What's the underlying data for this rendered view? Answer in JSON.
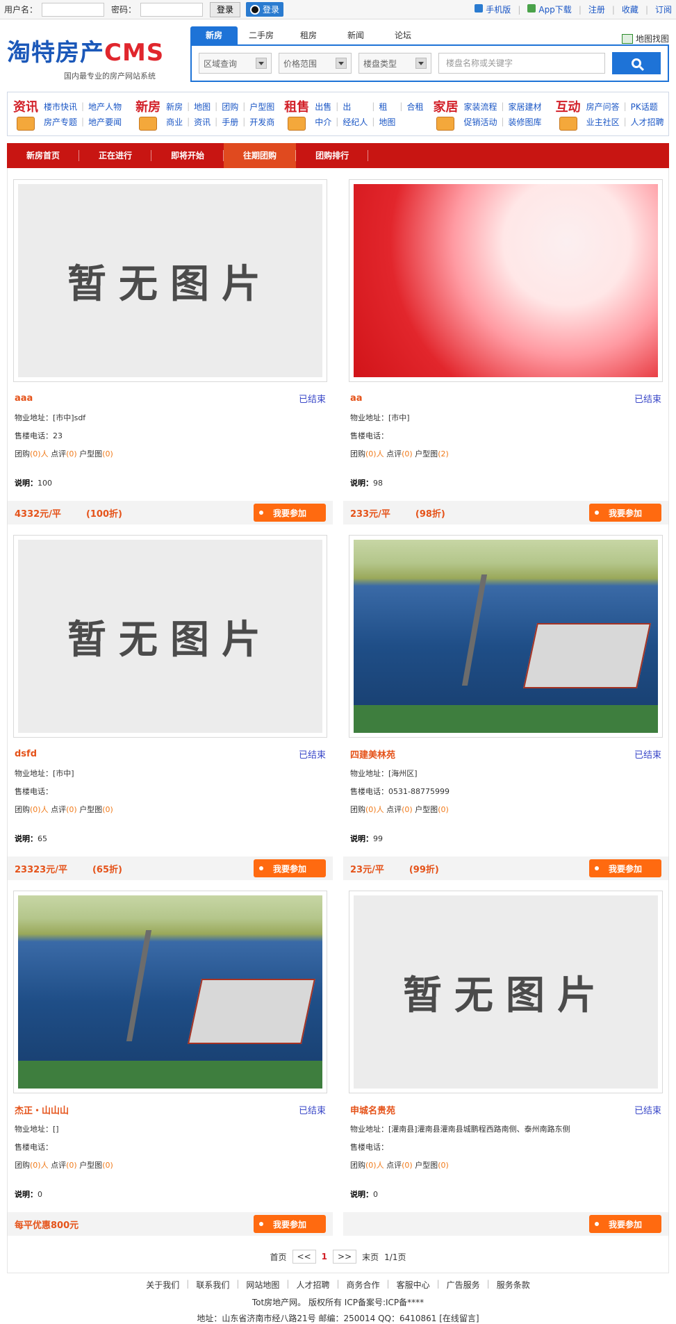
{
  "top": {
    "username_label": "用户名：",
    "password_label": "密码：",
    "login_button": "登录",
    "qq_login": "登录",
    "links": [
      {
        "label": "手机版"
      },
      {
        "label": "App下载"
      },
      {
        "label": "注册"
      },
      {
        "label": "收藏"
      },
      {
        "label": "订阅"
      }
    ]
  },
  "logo": {
    "name_cn": "淘特房产",
    "name_cms": "CMS",
    "tagline": "国内最专业的房产网站系统"
  },
  "search": {
    "tabs": [
      "新房",
      "二手房",
      "租房",
      "新闻",
      "论坛"
    ],
    "active_tab": "新房",
    "map_find": "地图找图",
    "dd1": "区域查询",
    "dd2": "价格范围",
    "dd3": "楼盘类型",
    "keyword_placeholder": "楼盘名称或关键字"
  },
  "nav": {
    "groups": [
      {
        "cat": "资讯",
        "links": [
          "楼市快讯",
          "地产人物",
          "房产专题",
          "地产要闻"
        ]
      },
      {
        "cat": "新房",
        "links": [
          "新房",
          "地图",
          "团购",
          "户型图",
          "商业",
          "资讯",
          "手册",
          "开发商"
        ]
      },
      {
        "cat": "租售",
        "links": [
          "出售",
          "出",
          "租",
          "合租",
          "中介",
          "经纪人",
          "地图"
        ]
      },
      {
        "cat": "家居",
        "links": [
          "家装流程",
          "家居建材",
          "促销活动",
          "装修图库"
        ]
      },
      {
        "cat": "互动",
        "links": [
          "房产问答",
          "PK话题",
          "业主社区",
          "人才招聘"
        ]
      }
    ]
  },
  "subnav": {
    "items": [
      "新房首页",
      "正在进行",
      "即将开始",
      "往期团购",
      "团购排行"
    ],
    "active": "往期团购"
  },
  "cards": [
    {
      "img_type": "placeholder",
      "img_text": "暂无图片",
      "title": "aaa",
      "status": "已结束",
      "address": "物业地址：[市中]sdf",
      "phone": "售楼电话：23",
      "counts_prefix": "团购",
      "counts": {
        "tuan": "(0)人",
        "dianping": "(0)",
        "huxing": "(0)"
      },
      "desc_label": "说明：",
      "desc_value": "100",
      "price": "4332元/平",
      "discount": "(100折)",
      "join": "我要参加"
    },
    {
      "img_type": "redblur",
      "img_text": "",
      "title": "aa",
      "status": "已结束",
      "address": "物业地址：[市中]",
      "phone": "售楼电话：",
      "counts_prefix": "团购",
      "counts": {
        "tuan": "(0)人",
        "dianping": "(0)",
        "huxing": "(2)"
      },
      "desc_label": "说明：",
      "desc_value": "98",
      "price": "233元/平",
      "discount": "(98折)",
      "join": "我要参加"
    },
    {
      "img_type": "placeholder",
      "img_text": "暂无图片",
      "title": "dsfd",
      "status": "已结束",
      "address": "物业地址：[市中]",
      "phone": "售楼电话：",
      "counts_prefix": "团购",
      "counts": {
        "tuan": "(0)人",
        "dianping": "(0)",
        "huxing": "(0)"
      },
      "desc_label": "说明：",
      "desc_value": "65",
      "price": "23323元/平",
      "discount": "(65折)",
      "join": "我要参加"
    },
    {
      "img_type": "lake",
      "img_text": "",
      "title": "四建美林苑",
      "status": "已结束",
      "address": "物业地址：[海州区]",
      "phone": "售楼电话：0531-88775999",
      "counts_prefix": "团购",
      "counts": {
        "tuan": "(0)人",
        "dianping": "(0)",
        "huxing": "(0)"
      },
      "desc_label": "说明：",
      "desc_value": "99",
      "price": "23元/平",
      "discount": "(99折)",
      "join": "我要参加"
    },
    {
      "img_type": "lake",
      "img_text": "",
      "title": "杰正・山山山",
      "status": "已结束",
      "address": "物业地址：[]",
      "phone": "售楼电话：",
      "counts_prefix": "团购",
      "counts": {
        "tuan": "(0)人",
        "dianping": "(0)",
        "huxing": "(0)"
      },
      "desc_label": "说明：",
      "desc_value": "0",
      "price": "每平优惠800元",
      "discount": "",
      "join": "我要参加"
    },
    {
      "img_type": "placeholder",
      "img_text": "暂无图片",
      "title": "申城名贵苑",
      "status": "已结束",
      "address": "物业地址：[灌南县]灌南县灌南县城鹏程西路南侧、泰州南路东侧",
      "phone": "售楼电话：",
      "counts_prefix": "团购",
      "counts": {
        "tuan": "(0)人",
        "dianping": "(0)",
        "huxing": "(0)"
      },
      "desc_label": "说明：",
      "desc_value": "0",
      "price": "",
      "discount": "",
      "join": "我要参加"
    }
  ],
  "pager": {
    "first": "首页",
    "prev": "<<",
    "current": "1",
    "next": ">>",
    "last": "末页",
    "info": "1/1页"
  },
  "footer": {
    "links": [
      "关于我们",
      "联系我们",
      "网站地图",
      "人才招聘",
      "商务合作",
      "客服中心",
      "广告服务",
      "服务条款"
    ],
    "line1": "Tot房地产网。 版权所有 ICP备案号:ICP备****",
    "line2": "地址：山东省济南市经八路21号 邮编：250014 QQ：6410861 [在线留言]"
  }
}
